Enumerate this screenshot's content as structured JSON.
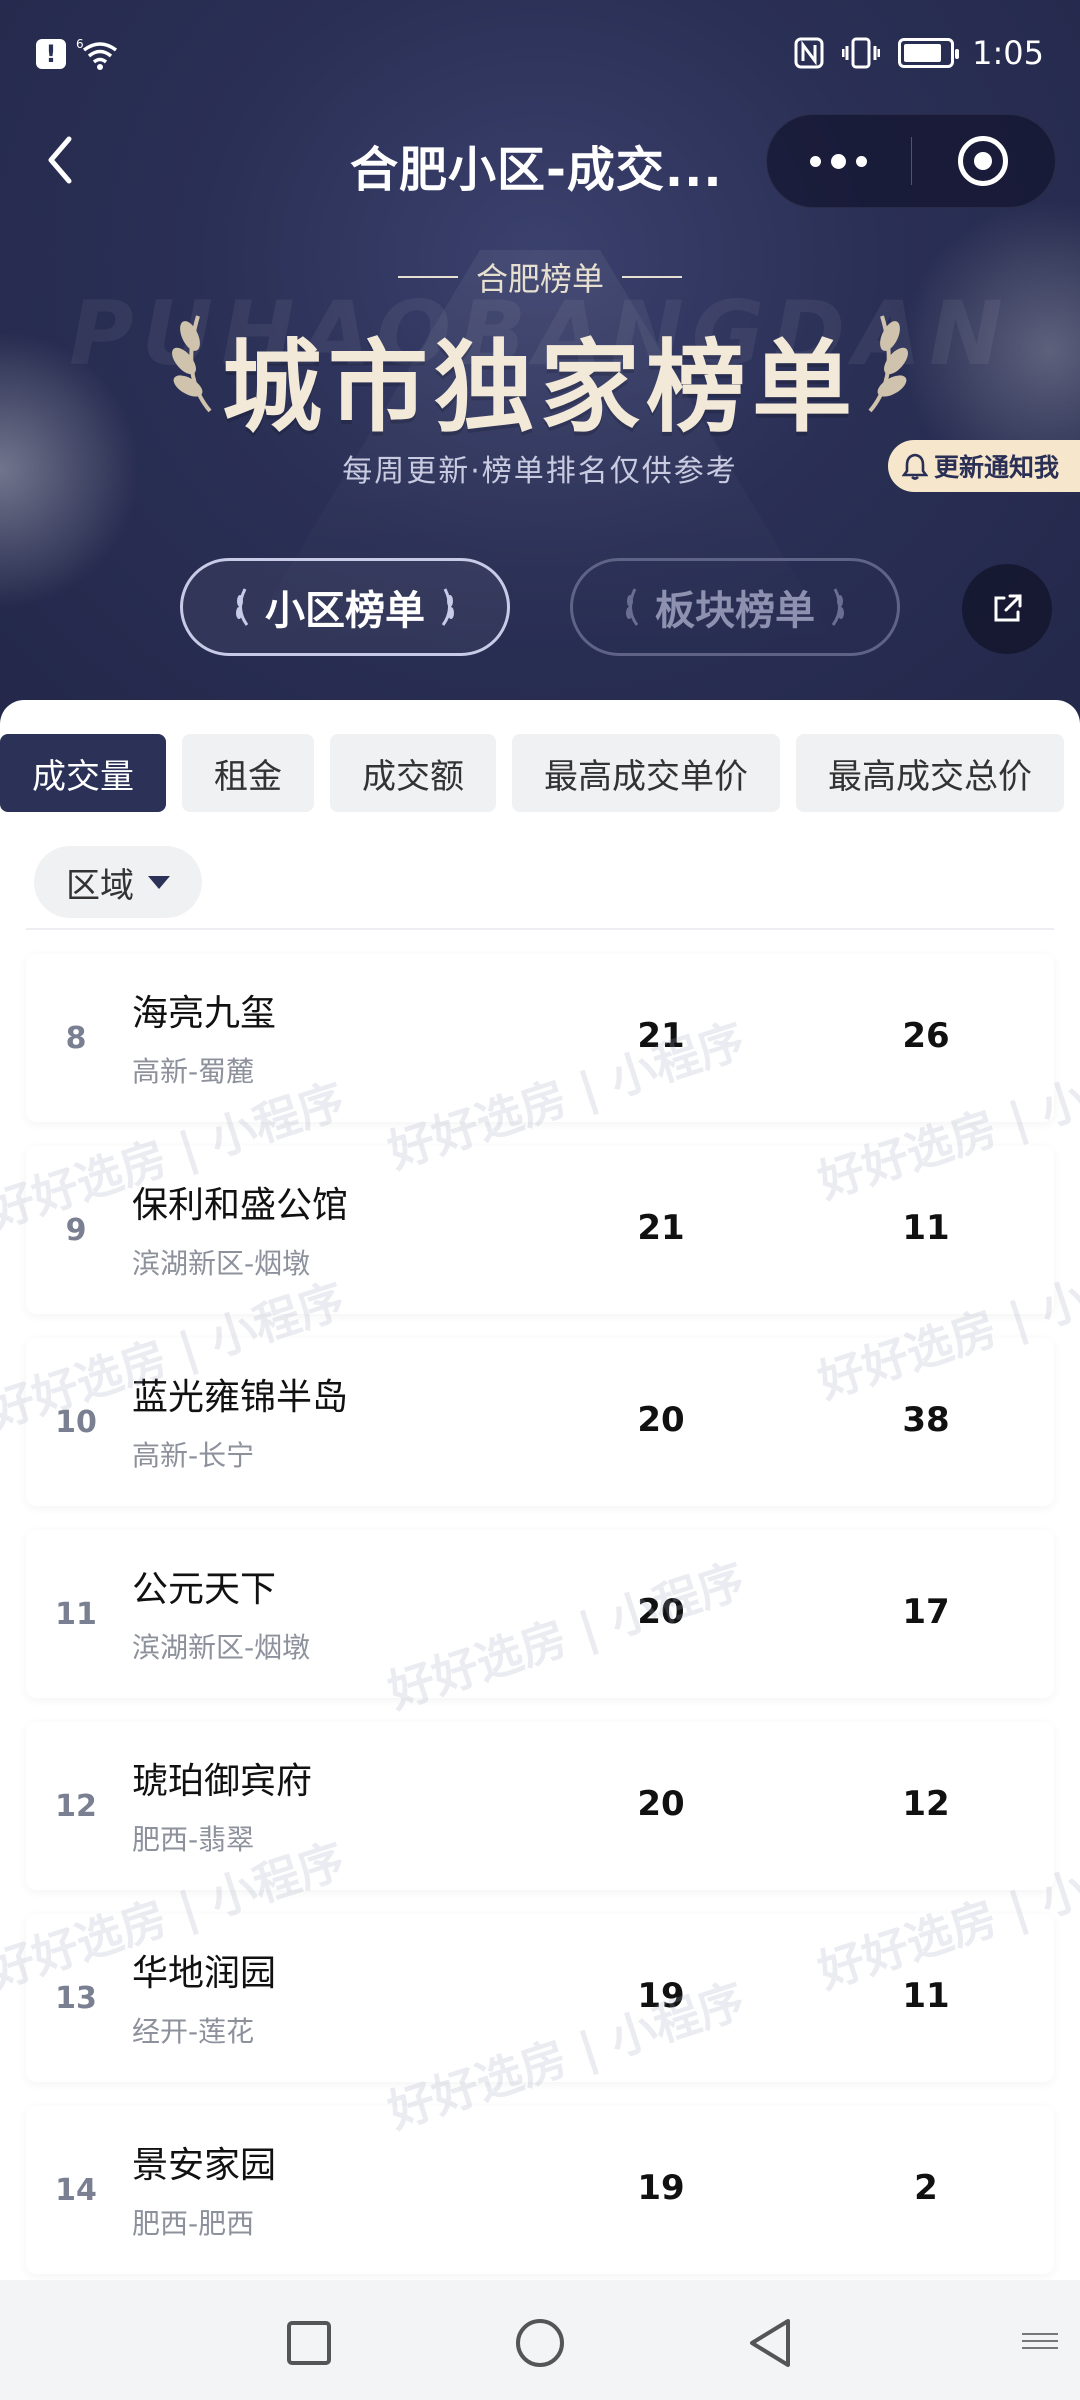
{
  "status": {
    "alert": "!",
    "signal": "6",
    "time": "1:05",
    "battery_level": 0.85
  },
  "nav": {
    "title": "合肥小区-成交..."
  },
  "hero": {
    "subtitle": "合肥榜单",
    "bg_word": "PUHAOBANGDAN",
    "title": "城市独家榜单",
    "desc": "每周更新·榜单排名仅供参考",
    "notify": "更新通知我",
    "rank_tabs": [
      {
        "label": "小区榜单",
        "active": true
      },
      {
        "label": "板块榜单",
        "active": false
      }
    ]
  },
  "tabs": [
    {
      "label": "成交量",
      "active": true
    },
    {
      "label": "租金",
      "active": false
    },
    {
      "label": "成交额",
      "active": false
    },
    {
      "label": "最高成交单价",
      "active": false
    },
    {
      "label": "最高成交总价",
      "active": false
    }
  ],
  "filter": {
    "label": "区域"
  },
  "rows": [
    {
      "rank": "8",
      "name": "海亮九玺",
      "area": "高新-蜀麓",
      "v1": "21",
      "v2": "26"
    },
    {
      "rank": "9",
      "name": "保利和盛公馆",
      "area": "滨湖新区-烟墩",
      "v1": "21",
      "v2": "11"
    },
    {
      "rank": "10",
      "name": "蓝光雍锦半岛",
      "area": "高新-长宁",
      "v1": "20",
      "v2": "38"
    },
    {
      "rank": "11",
      "name": "公元天下",
      "area": "滨湖新区-烟墩",
      "v1": "20",
      "v2": "17"
    },
    {
      "rank": "12",
      "name": "琥珀御宾府",
      "area": "肥西-翡翠",
      "v1": "20",
      "v2": "12"
    },
    {
      "rank": "13",
      "name": "华地润园",
      "area": "经开-莲花",
      "v1": "19",
      "v2": "11"
    },
    {
      "rank": "14",
      "name": "景安家园",
      "area": "肥西-肥西",
      "v1": "19",
      "v2": "2"
    }
  ],
  "watermark": "好好选房 | 小程序",
  "colors": {
    "hero_bg": "#2a2f55",
    "active_tab": "#2c3157",
    "gold_text": "#f3e9d8",
    "notify_bg": "#f6e6cc"
  },
  "icons": {
    "back": "chevron-left-icon",
    "more": "more-dots-icon",
    "close": "target-icon",
    "share": "share-icon",
    "bell": "bell-icon",
    "nav_square": "recent-apps-icon",
    "nav_circle": "home-icon",
    "nav_triangle": "back-triangle-icon"
  }
}
